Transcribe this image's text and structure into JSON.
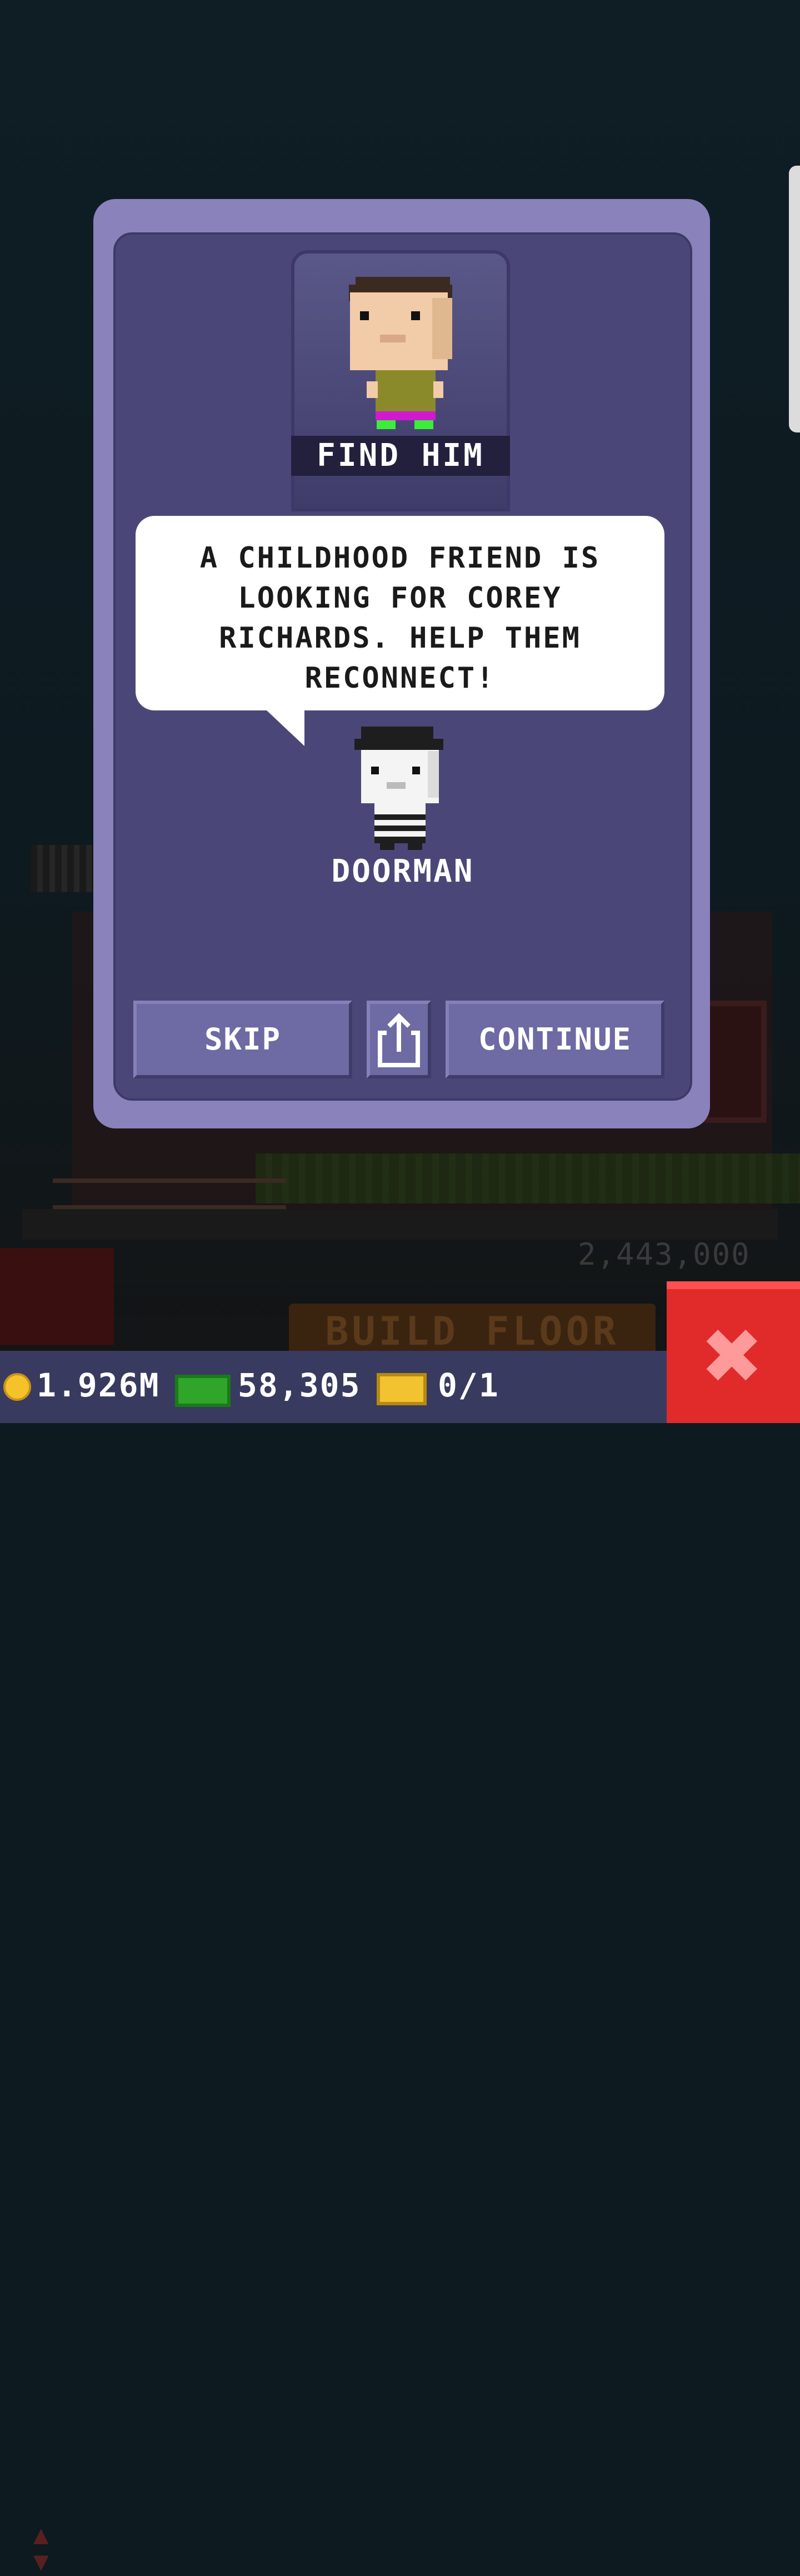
{
  "background": {
    "floor_price": "2,443,000",
    "build_floor_label": "BUILD FLOOR"
  },
  "dialog": {
    "portrait_caption": "FIND HIM",
    "message": "A CHILDHOOD FRIEND IS LOOKING FOR COREY RICHARDS. HELP THEM RECONNECT!",
    "npc_name": "DOORMAN",
    "skip_label": "SKIP",
    "continue_label": "CONTINUE",
    "share_icon": "share-icon"
  },
  "status_bar": {
    "coins": "1.926M",
    "bux": "58,305",
    "tickets": "0/1"
  },
  "colors": {
    "dialog_outer": "#8982bb",
    "dialog_inner": "#4a4778",
    "button": "#6e6aa3",
    "close_button": "#e12a2a"
  }
}
